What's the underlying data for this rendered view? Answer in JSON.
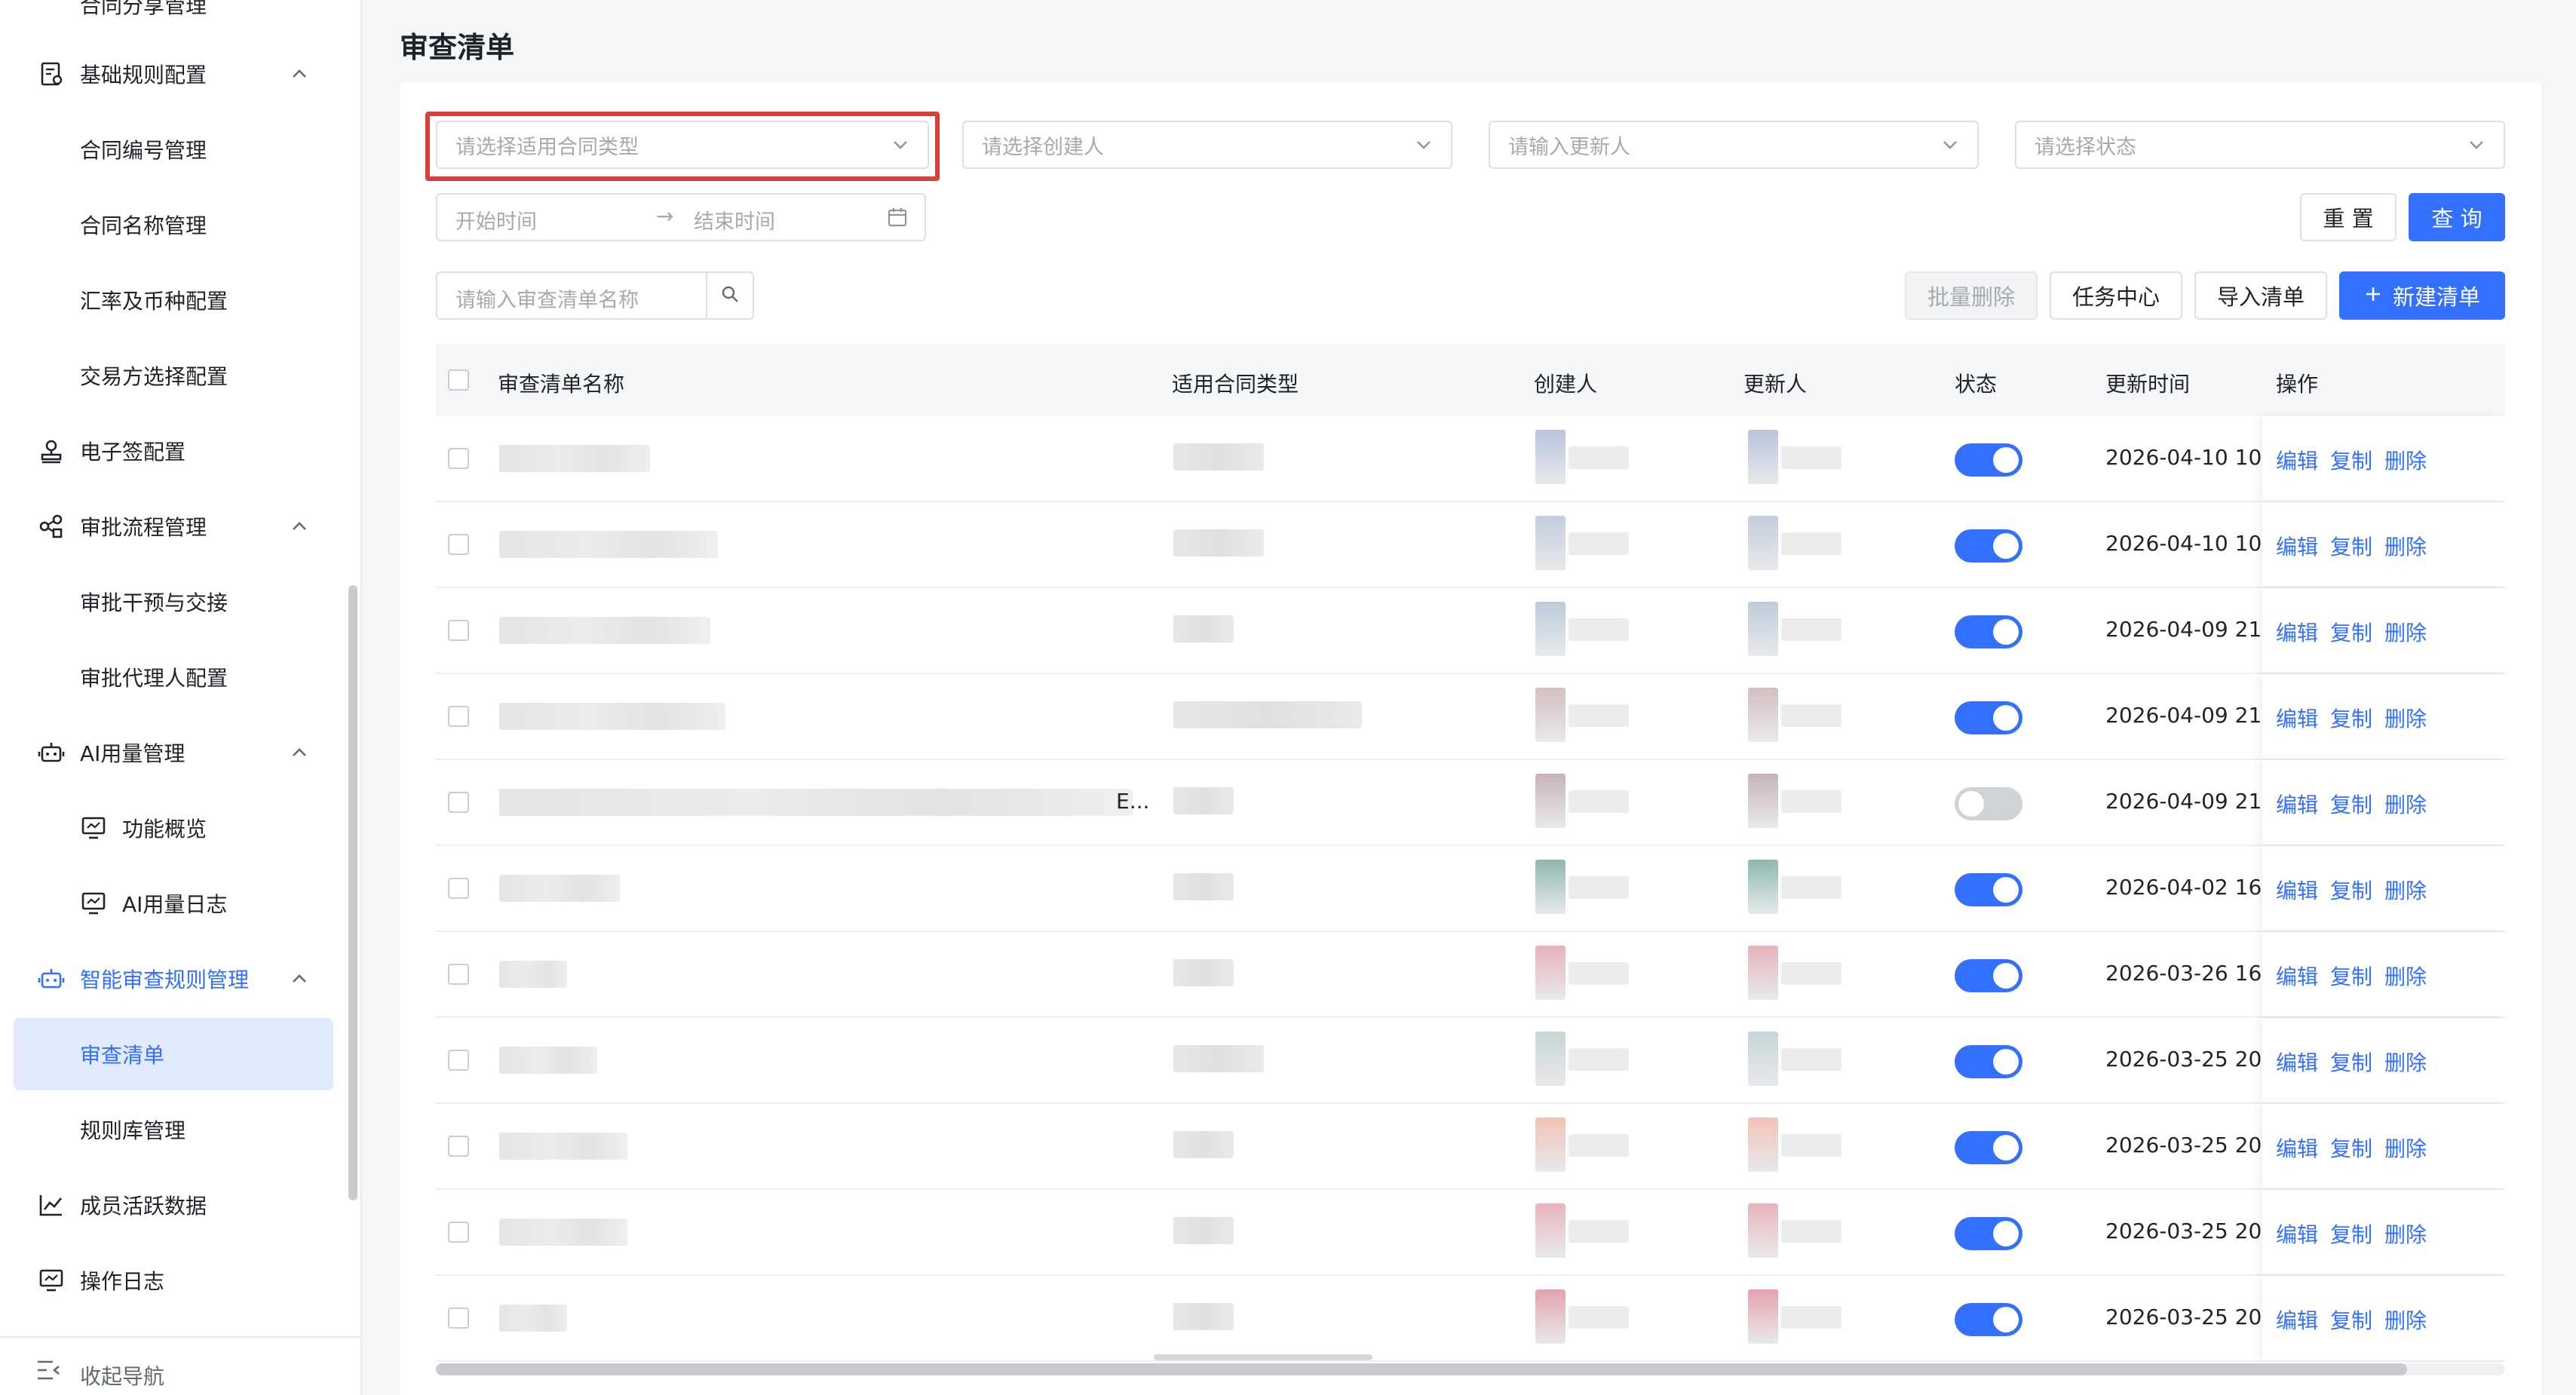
{
  "sidebar": {
    "cut_top_label": "合同分享管理",
    "items": [
      {
        "label": "基础规则配置",
        "icon": "rule-doc-icon",
        "type": "group",
        "expanded": true
      },
      {
        "label": "合同编号管理",
        "type": "sub"
      },
      {
        "label": "合同名称管理",
        "type": "sub"
      },
      {
        "label": "汇率及币种配置",
        "type": "sub"
      },
      {
        "label": "交易方选择配置",
        "type": "sub"
      },
      {
        "label": "电子签配置",
        "icon": "stamp-icon",
        "type": "item"
      },
      {
        "label": "审批流程管理",
        "icon": "workflow-icon",
        "type": "group",
        "expanded": true
      },
      {
        "label": "审批干预与交接",
        "type": "sub"
      },
      {
        "label": "审批代理人配置",
        "type": "sub"
      },
      {
        "label": "AI用量管理",
        "icon": "robot-icon",
        "type": "group",
        "expanded": true
      },
      {
        "label": "功能概览",
        "icon": "monitor-icon",
        "type": "sub2"
      },
      {
        "label": "AI用量日志",
        "icon": "monitor-icon",
        "type": "sub2"
      },
      {
        "label": "智能审查规则管理",
        "icon": "robot-icon",
        "type": "group",
        "expanded": true,
        "active": true
      },
      {
        "label": "审查清单",
        "type": "sub",
        "selected": true
      },
      {
        "label": "规则库管理",
        "type": "sub"
      },
      {
        "label": "成员活跃数据",
        "icon": "line-chart-icon",
        "type": "item"
      },
      {
        "label": "操作日志",
        "icon": "monitor-icon",
        "type": "item"
      }
    ],
    "collapse_label": "收起导航"
  },
  "page": {
    "title": "审查清单"
  },
  "filters": {
    "contract_type_placeholder": "请选择适用合同类型",
    "creator_placeholder": "请选择创建人",
    "updater_placeholder": "请输入更新人",
    "status_placeholder": "请选择状态",
    "start_time_placeholder": "开始时间",
    "end_time_placeholder": "结束时间",
    "reset_label": "重 置",
    "query_label": "查 询"
  },
  "toolbar": {
    "search_placeholder": "请输入审查清单名称",
    "batch_delete_label": "批量删除",
    "task_center_label": "任务中心",
    "import_label": "导入清单",
    "new_label": "新建清单"
  },
  "table": {
    "columns": [
      "审查清单名称",
      "适用合同类型",
      "创建人",
      "更新人",
      "状态",
      "更新时间",
      "操作"
    ],
    "actions": [
      "编辑",
      "复制",
      "删除"
    ],
    "rows": [
      {
        "status": true,
        "updated": "2026-04-10 10:"
      },
      {
        "status": true,
        "updated": "2026-04-10 10:"
      },
      {
        "status": true,
        "updated": "2026-04-09 21:"
      },
      {
        "status": true,
        "updated": "2026-04-09 21:"
      },
      {
        "status": false,
        "updated": "2026-04-09 21:",
        "name_suffix": "E..."
      },
      {
        "status": true,
        "updated": "2026-04-02 16:"
      },
      {
        "status": true,
        "updated": "2026-03-26 16:"
      },
      {
        "status": true,
        "updated": "2026-03-25 20:"
      },
      {
        "status": true,
        "updated": "2026-03-25 20:"
      },
      {
        "status": true,
        "updated": "2026-03-25 20:"
      },
      {
        "status": true,
        "updated": "2026-03-25 20:"
      }
    ]
  },
  "colors": {
    "primary": "#3370ff",
    "highlight_box": "#d9403a",
    "toggle_off": "#d0d3d6"
  }
}
